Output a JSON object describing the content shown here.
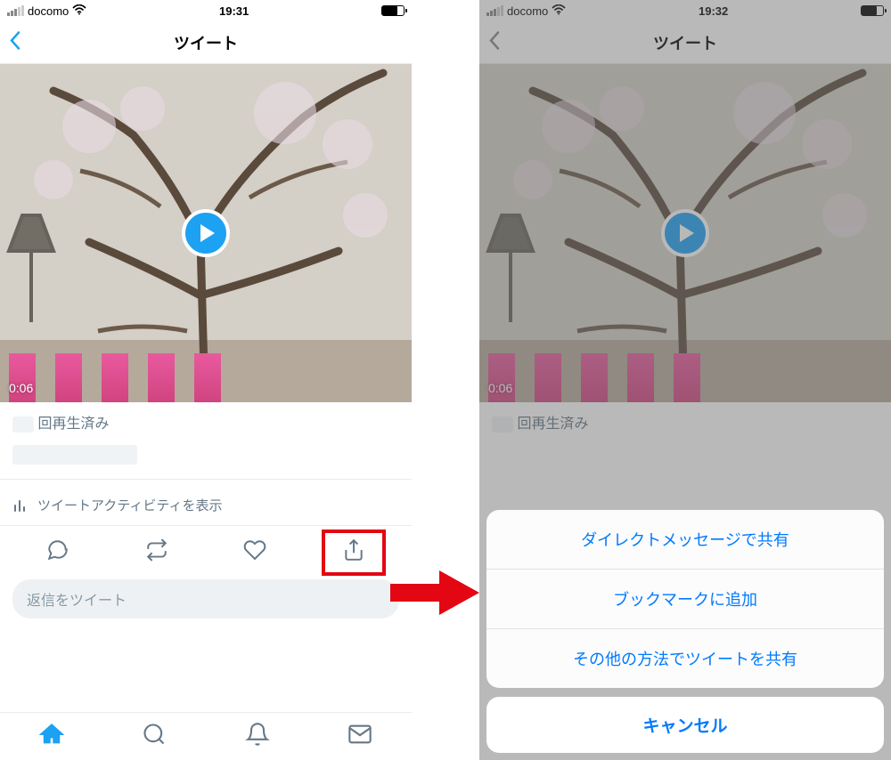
{
  "left": {
    "status": {
      "carrier": "docomo",
      "time": "19:31"
    },
    "nav": {
      "title": "ツイート"
    },
    "video": {
      "duration": "0:06"
    },
    "meta": {
      "played_label": "回再生済み"
    },
    "activity": {
      "label": "ツイートアクティビティを表示"
    },
    "reply": {
      "placeholder": "返信をツイート"
    }
  },
  "right": {
    "status": {
      "carrier": "docomo",
      "time": "19:32"
    },
    "nav": {
      "title": "ツイート"
    },
    "video": {
      "duration": "0:06"
    },
    "meta": {
      "played_label": "回再生済み"
    },
    "sheet": {
      "items": [
        "ダイレクトメッセージで共有",
        "ブックマークに追加",
        "その他の方法でツイートを共有"
      ],
      "cancel": "キャンセル"
    }
  }
}
